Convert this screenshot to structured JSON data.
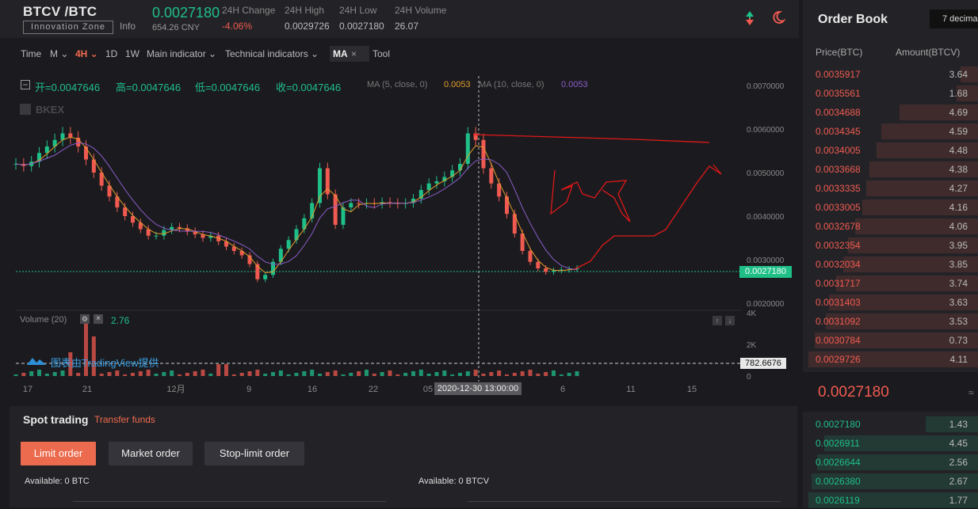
{
  "header": {
    "pair": "BTCV /BTC",
    "zone": "Innovation Zone",
    "info": "Info",
    "last_price": "0.0027180",
    "cny": "654.26 CNY",
    "stats": [
      {
        "label": "24H Change",
        "value": "-4.06%"
      },
      {
        "label": "24H High",
        "value": "0.0029726"
      },
      {
        "label": "24H Low",
        "value": "0.0027180"
      },
      {
        "label": "24H Volume",
        "value": "26.07"
      }
    ]
  },
  "toolbar": {
    "time": "Time",
    "m": "M",
    "h4": "4H",
    "d1": "1D",
    "w1": "1W",
    "main_indicator": "Main indicator",
    "technical_indicators": "Technical indicators",
    "ma": "MA",
    "ma_close": "×",
    "tool": "Tool"
  },
  "legend": {
    "open": "开=0.0047646",
    "high": "高=0.0047646",
    "low": "低=0.0047646",
    "close": "收=0.0047646",
    "ma5_label": "MA (5, close, 0)",
    "ma5_val": "0.0053",
    "ma10_label": "MA (10, close, 0)",
    "ma10_val": "0.0053",
    "watermark": "BKEX"
  },
  "volume": {
    "label": "Volume (20)",
    "value": "2.76",
    "tradingview": "图表由TradingView提供",
    "current": "782.6676"
  },
  "chart_data": {
    "type": "line",
    "title": "",
    "price_axis": [
      "0.0070000",
      "0.0060000",
      "0.0050000",
      "0.0040000",
      "0.0030000",
      "0.0020000"
    ],
    "volume_axis": [
      "4K",
      "2K",
      "0"
    ],
    "x_ticks": [
      "17",
      "21",
      "12月",
      "9",
      "16",
      "22",
      "05",
      "6",
      "11",
      "15"
    ],
    "crosshair_label": "2020-12-30 13:00:00",
    "current_price": "0.0027180",
    "ylim": [
      0.0018,
      0.007
    ],
    "close_series": [
      0.0052,
      0.00515,
      0.00525,
      0.00545,
      0.0056,
      0.00575,
      0.0059,
      0.0058,
      0.0056,
      0.0053,
      0.005,
      0.0047,
      0.00445,
      0.0042,
      0.004,
      0.00385,
      0.0037,
      0.00355,
      0.00355,
      0.00368,
      0.00375,
      0.00372,
      0.00365,
      0.00358,
      0.0035,
      0.00355,
      0.00342,
      0.0033,
      0.0032,
      0.0031,
      0.0029,
      0.00255,
      0.00265,
      0.00295,
      0.00325,
      0.00345,
      0.0037,
      0.00395,
      0.0043,
      0.0051,
      0.0045,
      0.0038,
      0.0042,
      0.0043,
      0.00428,
      0.0043,
      0.00428,
      0.00432,
      0.0043,
      0.00428,
      0.0043,
      0.0044,
      0.0046,
      0.00475,
      0.0048,
      0.0049,
      0.00505,
      0.0052,
      0.0059,
      0.00575,
      0.0051,
      0.00475,
      0.00445,
      0.00405,
      0.0036,
      0.0032,
      0.00295,
      0.0028,
      0.00272,
      0.00275,
      0.00277,
      0.00278,
      0.0028
    ]
  },
  "orderbook": {
    "title": "Order Book",
    "decimals": "7 decimal",
    "price_header": "Price(BTC)",
    "amount_header": "Amount(BTCV)",
    "asks": [
      {
        "price": "0.0035917",
        "amount": "3.64",
        "depth": 0.1
      },
      {
        "price": "0.0035561",
        "amount": "1.68",
        "depth": 0.12
      },
      {
        "price": "0.0034688",
        "amount": "4.69",
        "depth": 0.45
      },
      {
        "price": "0.0034345",
        "amount": "4.59",
        "depth": 0.55
      },
      {
        "price": "0.0034005",
        "amount": "4.48",
        "depth": 0.58
      },
      {
        "price": "0.0033668",
        "amount": "4.38",
        "depth": 0.62
      },
      {
        "price": "0.0033335",
        "amount": "4.27",
        "depth": 0.64
      },
      {
        "price": "0.0033005",
        "amount": "4.16",
        "depth": 0.66
      },
      {
        "price": "0.0032678",
        "amount": "4.06",
        "depth": 0.7
      },
      {
        "price": "0.0032354",
        "amount": "3.95",
        "depth": 0.74
      },
      {
        "price": "0.0032034",
        "amount": "3.85",
        "depth": 0.77
      },
      {
        "price": "0.0031717",
        "amount": "3.74",
        "depth": 0.81
      },
      {
        "price": "0.0031403",
        "amount": "3.63",
        "depth": 0.85
      },
      {
        "price": "0.0031092",
        "amount": "3.53",
        "depth": 0.87
      },
      {
        "price": "0.0030784",
        "amount": "0.73",
        "depth": 0.93
      },
      {
        "price": "0.0029726",
        "amount": "4.11",
        "depth": 0.97
      }
    ],
    "mid_price": "0.0027180",
    "bids": [
      {
        "price": "0.0027180",
        "amount": "1.43",
        "depth": 0.3
      },
      {
        "price": "0.0026911",
        "amount": "4.45",
        "depth": 0.88
      },
      {
        "price": "0.0026644",
        "amount": "2.56",
        "depth": 0.92
      },
      {
        "price": "0.0026380",
        "amount": "2.67",
        "depth": 0.95
      },
      {
        "price": "0.0026119",
        "amount": "1.77",
        "depth": 0.97
      }
    ]
  },
  "spot": {
    "title": "Spot trading",
    "transfer": "Transfer funds",
    "limit_order": "Limit order",
    "market_order": "Market order",
    "stop_limit_order": "Stop-limit order",
    "available_btc": "Available: 0  BTC",
    "available_btcv": "Available: 0  BTCV"
  },
  "colors": {
    "accent": "#f26a4f",
    "up": "#1fbf88",
    "down": "#f05a50"
  }
}
